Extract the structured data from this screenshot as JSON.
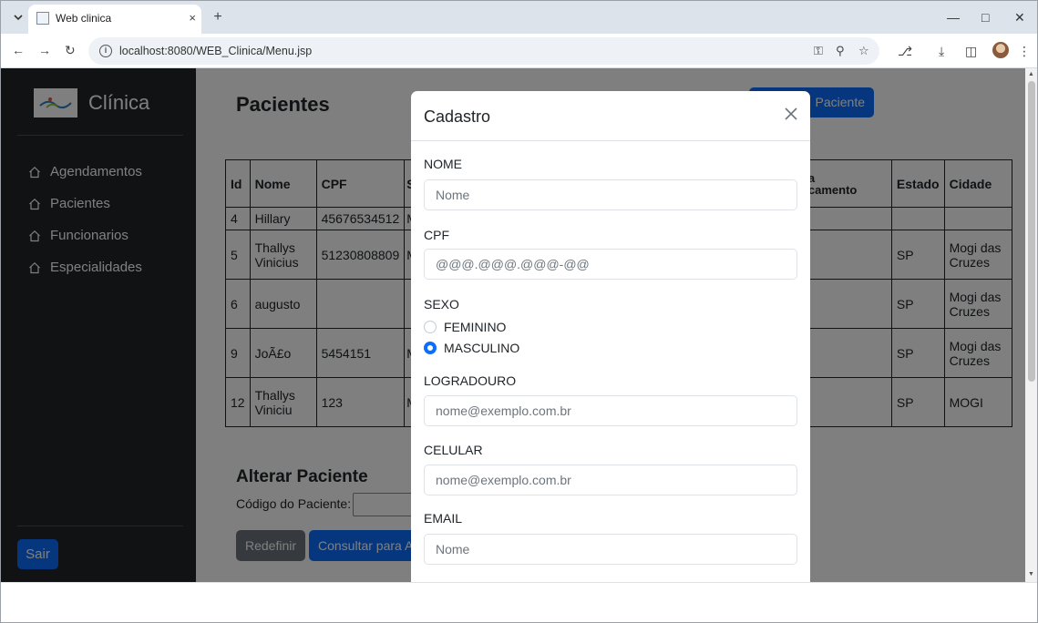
{
  "browser": {
    "tab_title": "Web clinica",
    "url": "localhost:8080/WEB_Clinica/Menu.jsp",
    "new_tab_label": "+",
    "tab_close_label": "×"
  },
  "sidebar": {
    "brand": "Clínica",
    "items": [
      {
        "label": "Agendamentos"
      },
      {
        "label": "Pacientes"
      },
      {
        "label": "Funcionarios"
      },
      {
        "label": "Especialidades"
      }
    ],
    "logout_label": "Sair"
  },
  "main": {
    "title": "Pacientes",
    "add_button_label": "Paciente",
    "table": {
      "headers": [
        "Id",
        "Nome",
        "CPF",
        "S",
        "a\ncamento",
        "Estado",
        "Cidade"
      ],
      "rows": [
        {
          "id": "4",
          "nome": "Hillary",
          "cpf": "45676534512",
          "s": "M",
          "nasc": "",
          "estado": "",
          "cidade": ""
        },
        {
          "id": "5",
          "nome": "Thallys Vinicius",
          "cpf": "51230808809",
          "s": "M",
          "nasc": "",
          "estado": "SP",
          "cidade": "Mogi das Cruzes"
        },
        {
          "id": "6",
          "nome": "augusto",
          "cpf": "",
          "s": "",
          "nasc": "",
          "estado": "SP",
          "cidade": "Mogi das Cruzes"
        },
        {
          "id": "9",
          "nome": "JoÃ£o",
          "cpf": "5454151",
          "s": "M",
          "nasc": "",
          "estado": "SP",
          "cidade": "Mogi das Cruzes"
        },
        {
          "id": "12",
          "nome": "Thallys Viniciu",
          "cpf": "123",
          "s": "M",
          "nasc": "",
          "estado": "SP",
          "cidade": "MOGI"
        }
      ]
    },
    "alter": {
      "title": "Alterar Paciente",
      "code_label": "Código do Paciente:",
      "reset_label": "Redefinir",
      "consult_label": "Consultar para A"
    }
  },
  "modal": {
    "title": "Cadastro",
    "nome_label": "NOME",
    "nome_placeholder": "Nome",
    "cpf_label": "CPF",
    "cpf_placeholder": "@@@.@@@.@@@-@@",
    "sexo_label": "SEXO",
    "sexo_options": [
      "FEMININO",
      "MASCULINO"
    ],
    "sexo_selected": "MASCULINO",
    "logradouro_label": "LOGRADOURO",
    "logradouro_placeholder": "nome@exemplo.com.br",
    "celular_label": "CELULAR",
    "celular_placeholder": "nome@exemplo.com.br",
    "email_label": "EMAIL",
    "email_placeholder": "Nome"
  },
  "colors": {
    "sidebar_bg": "#212529",
    "primary": "#0d6efd",
    "secondary": "#6c757d"
  }
}
